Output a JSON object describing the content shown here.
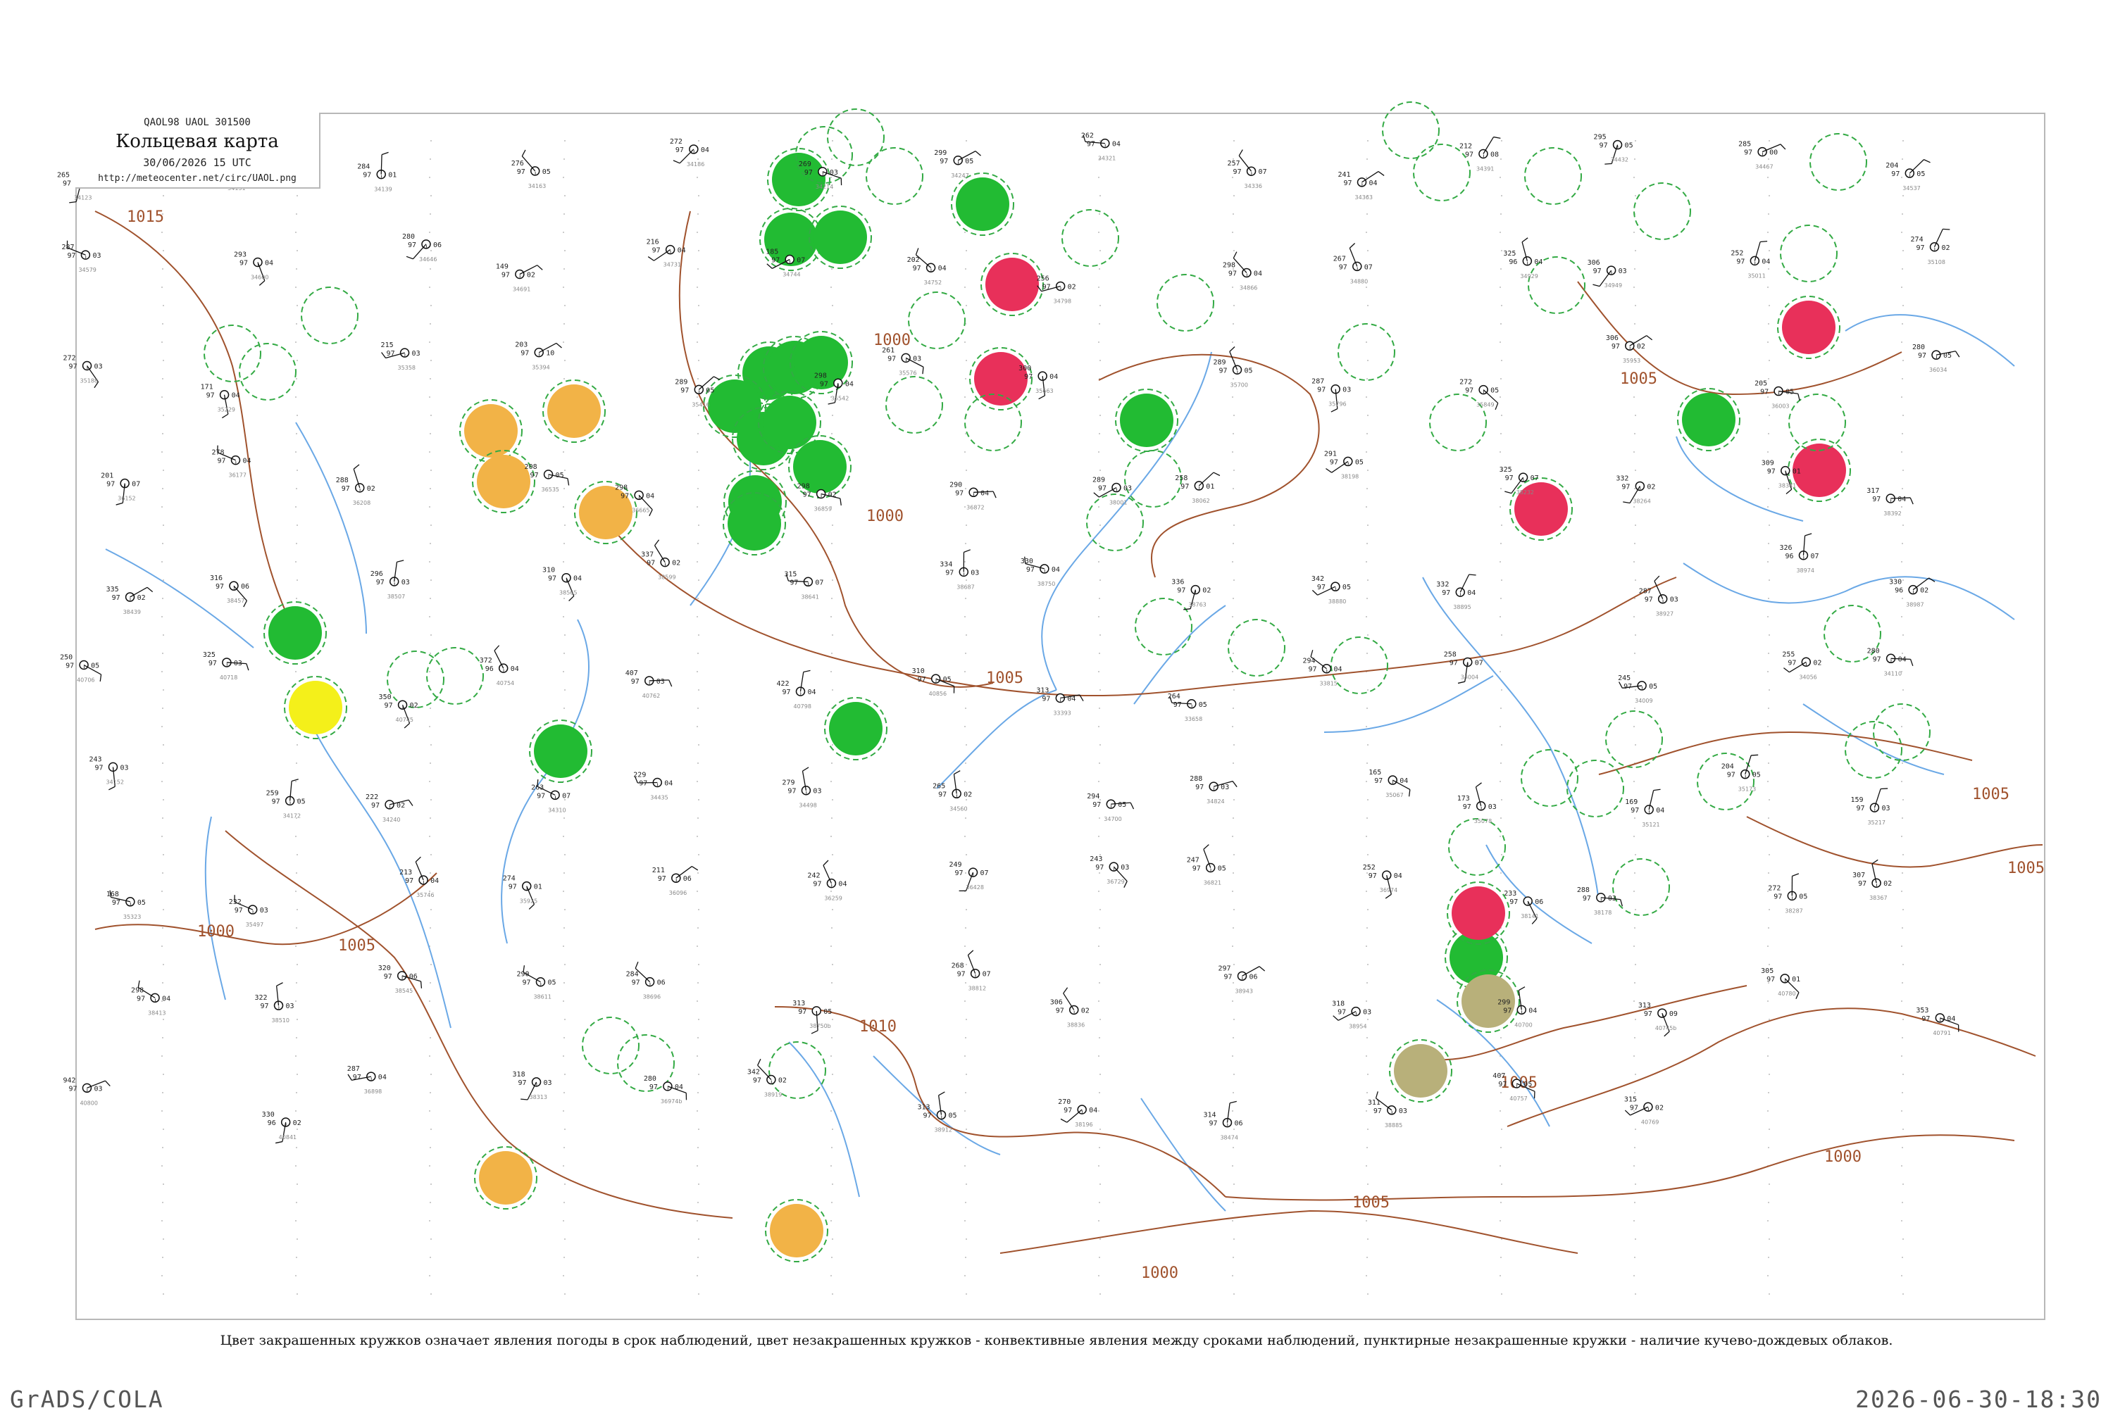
{
  "header": {
    "code": "QAOL98 UAOL 301500",
    "title": "Кольцевая карта",
    "date": "30/06/2026 15 UTC",
    "url": "http://meteocenter.net/circ/UAOL.png"
  },
  "caption": "Цвет закрашенных кружков означает явления погоды в срок наблюдений, цвет незакрашенных кружков - конвективные явления между сроками наблюдений, пунктирные незакрашенные кружки - наличие кучево-дождевых облаков.",
  "footer": {
    "left": "GrADS/COLA",
    "right": "2026-06-30-18:30"
  },
  "colors": {
    "isobar": "#a0522d",
    "river": "#6aa8e6",
    "thunder": "#22bb33",
    "rain": "#e8305a",
    "haze": "#f2b347",
    "dust": "#b8b07a",
    "fog": "#f4f01a",
    "cb_dashed": "#33aa44"
  },
  "isobars": [
    {
      "label": "1015"
    },
    {
      "label": "1010"
    },
    {
      "label": "1005"
    },
    {
      "label": "1000"
    },
    {
      "label": "995"
    }
  ],
  "stations": [
    {
      "code": "34123",
      "t": "265",
      "p": "97",
      "v": "05"
    },
    {
      "code": "34131",
      "t": "280",
      "p": "97",
      "v": "07"
    },
    {
      "code": "34139",
      "t": "284",
      "p": "97",
      "v": "01"
    },
    {
      "code": "34163",
      "t": "276",
      "p": "97",
      "v": "05"
    },
    {
      "code": "34186",
      "t": "272",
      "p": "97",
      "v": "04"
    },
    {
      "code": "34214",
      "t": "269",
      "p": "97",
      "v": "03"
    },
    {
      "code": "34247",
      "t": "299",
      "p": "97",
      "v": "05"
    },
    {
      "code": "34321",
      "t": "262",
      "p": "97",
      "v": "04"
    },
    {
      "code": "34336",
      "t": "257",
      "p": "97",
      "v": "07"
    },
    {
      "code": "34363",
      "t": "241",
      "p": "97",
      "v": "04"
    },
    {
      "code": "34391",
      "t": "212",
      "p": "97",
      "v": "08"
    },
    {
      "code": "34432",
      "t": "295",
      "p": "97",
      "v": "05"
    },
    {
      "code": "34467",
      "t": "285",
      "p": "97",
      "v": "00"
    },
    {
      "code": "34537",
      "t": "204",
      "p": "97",
      "v": "05"
    },
    {
      "code": "34579",
      "t": "287",
      "p": "97",
      "v": "03"
    },
    {
      "code": "34600",
      "t": "293",
      "p": "97",
      "v": "04"
    },
    {
      "code": "34646",
      "t": "280",
      "p": "97",
      "v": "06"
    },
    {
      "code": "34691",
      "t": "149",
      "p": "97",
      "v": "02"
    },
    {
      "code": "34731",
      "t": "216",
      "p": "97",
      "v": "04"
    },
    {
      "code": "34744",
      "t": "185",
      "p": "97",
      "v": "07"
    },
    {
      "code": "34752",
      "t": "202",
      "p": "97",
      "v": "04"
    },
    {
      "code": "34798",
      "t": "256",
      "p": "97",
      "v": "02"
    },
    {
      "code": "34866",
      "t": "298",
      "p": "97",
      "v": "04"
    },
    {
      "code": "34880",
      "t": "267",
      "p": "97",
      "v": "07"
    },
    {
      "code": "34929",
      "t": "325",
      "p": "96",
      "v": "04"
    },
    {
      "code": "34949",
      "t": "306",
      "p": "97",
      "v": "03"
    },
    {
      "code": "35011",
      "t": "252",
      "p": "97",
      "v": "04"
    },
    {
      "code": "35108",
      "t": "274",
      "p": "97",
      "v": "02"
    },
    {
      "code": "35188",
      "t": "272",
      "p": "97",
      "v": "03"
    },
    {
      "code": "35229",
      "t": "171",
      "p": "97",
      "v": "04"
    },
    {
      "code": "35358",
      "t": "215",
      "p": "97",
      "v": "03"
    },
    {
      "code": "35394",
      "t": "203",
      "p": "97",
      "v": "10"
    },
    {
      "code": "35416",
      "t": "289",
      "p": "97",
      "v": "05"
    },
    {
      "code": "35542",
      "t": "298",
      "p": "97",
      "v": "04"
    },
    {
      "code": "35576",
      "t": "261",
      "p": "97",
      "v": "03"
    },
    {
      "code": "35663",
      "t": "300",
      "p": "97",
      "v": "04"
    },
    {
      "code": "35700",
      "t": "289",
      "p": "97",
      "v": "05"
    },
    {
      "code": "35796",
      "t": "287",
      "p": "97",
      "v": "03"
    },
    {
      "code": "35849",
      "t": "272",
      "p": "97",
      "v": "05"
    },
    {
      "code": "35953",
      "t": "306",
      "p": "97",
      "v": "02"
    },
    {
      "code": "36003",
      "t": "205",
      "p": "97",
      "v": "05"
    },
    {
      "code": "36034",
      "t": "280",
      "p": "97",
      "v": "05"
    },
    {
      "code": "36152",
      "t": "201",
      "p": "97",
      "v": "07"
    },
    {
      "code": "36177",
      "t": "278",
      "p": "97",
      "v": "04"
    },
    {
      "code": "36208",
      "t": "288",
      "p": "97",
      "v": "02"
    },
    {
      "code": "36535",
      "t": "208",
      "p": "97",
      "v": "05"
    },
    {
      "code": "36665",
      "t": "298",
      "p": "97",
      "v": "04"
    },
    {
      "code": "36859",
      "t": "298",
      "p": "97",
      "v": "02"
    },
    {
      "code": "36872",
      "t": "290",
      "p": "97",
      "v": "04"
    },
    {
      "code": "38001",
      "t": "289",
      "p": "97",
      "v": "03"
    },
    {
      "code": "38062",
      "t": "258",
      "p": "97",
      "v": "01"
    },
    {
      "code": "38198",
      "t": "291",
      "p": "97",
      "v": "05"
    },
    {
      "code": "38232",
      "t": "325",
      "p": "97",
      "v": "07"
    },
    {
      "code": "38264",
      "t": "332",
      "p": "97",
      "v": "02"
    },
    {
      "code": "38341",
      "t": "309",
      "p": "97",
      "v": "01"
    },
    {
      "code": "38392",
      "t": "317",
      "p": "97",
      "v": "04"
    },
    {
      "code": "38439",
      "t": "335",
      "p": "97",
      "v": "02"
    },
    {
      "code": "38457",
      "t": "316",
      "p": "97",
      "v": "06"
    },
    {
      "code": "38507",
      "t": "296",
      "p": "97",
      "v": "03"
    },
    {
      "code": "38565",
      "t": "310",
      "p": "97",
      "v": "04"
    },
    {
      "code": "38599",
      "t": "337",
      "p": "97",
      "v": "02"
    },
    {
      "code": "38641",
      "t": "315",
      "p": "97",
      "v": "07"
    },
    {
      "code": "38687",
      "t": "334",
      "p": "97",
      "v": "03"
    },
    {
      "code": "38750",
      "t": "330",
      "p": "97",
      "v": "04"
    },
    {
      "code": "38763",
      "t": "336",
      "p": "97",
      "v": "02"
    },
    {
      "code": "38880",
      "t": "342",
      "p": "97",
      "v": "05"
    },
    {
      "code": "38895",
      "t": "332",
      "p": "97",
      "v": "04"
    },
    {
      "code": "38927",
      "t": "287",
      "p": "97",
      "v": "03"
    },
    {
      "code": "38974",
      "t": "326",
      "p": "96",
      "v": "07"
    },
    {
      "code": "38987",
      "t": "330",
      "p": "96",
      "v": "02"
    },
    {
      "code": "40706",
      "t": "250",
      "p": "97",
      "v": "05"
    },
    {
      "code": "40718",
      "t": "325",
      "p": "97",
      "v": "03"
    },
    {
      "code": "40745",
      "t": "350",
      "p": "97",
      "v": "02"
    },
    {
      "code": "40754",
      "t": "372",
      "p": "96",
      "v": "04"
    },
    {
      "code": "40762",
      "t": "407",
      "p": "97",
      "v": "03"
    },
    {
      "code": "40798",
      "t": "422",
      "p": "97",
      "v": "04"
    },
    {
      "code": "40856",
      "t": "310",
      "p": "97",
      "v": "05"
    },
    {
      "code": "33393",
      "t": "313",
      "p": "97",
      "v": "04"
    },
    {
      "code": "33658",
      "t": "264",
      "p": "97",
      "v": "05"
    },
    {
      "code": "33815",
      "t": "294",
      "p": "97",
      "v": "04"
    },
    {
      "code": "34004",
      "t": "258",
      "p": "97",
      "v": "07"
    },
    {
      "code": "34009",
      "t": "245",
      "p": "97",
      "v": "05"
    },
    {
      "code": "34056",
      "t": "255",
      "p": "97",
      "v": "02"
    },
    {
      "code": "34110",
      "t": "280",
      "p": "97",
      "v": "04"
    },
    {
      "code": "34152",
      "t": "243",
      "p": "97",
      "v": "03"
    },
    {
      "code": "34172",
      "t": "259",
      "p": "97",
      "v": "05"
    },
    {
      "code": "34240",
      "t": "222",
      "p": "97",
      "v": "02"
    },
    {
      "code": "34310",
      "t": "263",
      "p": "97",
      "v": "07"
    },
    {
      "code": "34435",
      "t": "229",
      "p": "97",
      "v": "04"
    },
    {
      "code": "34498",
      "t": "279",
      "p": "97",
      "v": "03"
    },
    {
      "code": "34560",
      "t": "265",
      "p": "97",
      "v": "02"
    },
    {
      "code": "34700",
      "t": "294",
      "p": "97",
      "v": "05"
    },
    {
      "code": "34824",
      "t": "288",
      "p": "97",
      "v": "03"
    },
    {
      "code": "35067",
      "t": "165",
      "p": "97",
      "v": "04"
    },
    {
      "code": "35078",
      "t": "173",
      "p": "97",
      "v": "03"
    },
    {
      "code": "35121",
      "t": "169",
      "p": "97",
      "v": "04"
    },
    {
      "code": "35173",
      "t": "204",
      "p": "97",
      "v": "05"
    },
    {
      "code": "35217",
      "t": "159",
      "p": "97",
      "v": "03"
    },
    {
      "code": "35323",
      "t": "168",
      "p": "97",
      "v": "05"
    },
    {
      "code": "35497",
      "t": "232",
      "p": "97",
      "v": "03"
    },
    {
      "code": "35746",
      "t": "213",
      "p": "97",
      "v": "04"
    },
    {
      "code": "35925",
      "t": "274",
      "p": "97",
      "v": "01"
    },
    {
      "code": "36096",
      "t": "211",
      "p": "97",
      "v": "06"
    },
    {
      "code": "36259",
      "t": "242",
      "p": "97",
      "v": "04"
    },
    {
      "code": "36428",
      "t": "249",
      "p": "97",
      "v": "07"
    },
    {
      "code": "36729",
      "t": "243",
      "p": "97",
      "v": "03"
    },
    {
      "code": "36821",
      "t": "247",
      "p": "97",
      "v": "05"
    },
    {
      "code": "36974",
      "t": "252",
      "p": "97",
      "v": "04"
    },
    {
      "code": "38141",
      "t": "233",
      "p": "97",
      "v": "06"
    },
    {
      "code": "38178",
      "t": "288",
      "p": "97",
      "v": "03"
    },
    {
      "code": "38287",
      "t": "272",
      "p": "97",
      "v": "05"
    },
    {
      "code": "38367",
      "t": "307",
      "p": "97",
      "v": "02"
    },
    {
      "code": "38413",
      "t": "298",
      "p": "97",
      "v": "04"
    },
    {
      "code": "38510",
      "t": "322",
      "p": "97",
      "v": "03"
    },
    {
      "code": "38545",
      "t": "320",
      "p": "97",
      "v": "06"
    },
    {
      "code": "38611",
      "t": "290",
      "p": "97",
      "v": "05"
    },
    {
      "code": "38696",
      "t": "284",
      "p": "97",
      "v": "06"
    },
    {
      "code": "38750b",
      "t": "313",
      "p": "97",
      "v": "05"
    },
    {
      "code": "38812",
      "t": "268",
      "p": "97",
      "v": "07"
    },
    {
      "code": "38836",
      "t": "306",
      "p": "97",
      "v": "02"
    },
    {
      "code": "38943",
      "t": "297",
      "p": "97",
      "v": "06"
    },
    {
      "code": "38954",
      "t": "318",
      "p": "97",
      "v": "03"
    },
    {
      "code": "40700",
      "t": "299",
      "p": "97",
      "v": "04"
    },
    {
      "code": "40745b",
      "t": "313",
      "p": "97",
      "v": "09"
    },
    {
      "code": "40780",
      "t": "305",
      "p": "97",
      "v": "01"
    },
    {
      "code": "40791",
      "t": "353",
      "p": "97",
      "v": "04"
    },
    {
      "code": "40800",
      "t": "942",
      "p": "97",
      "v": "03"
    },
    {
      "code": "40841",
      "t": "330",
      "p": "96",
      "v": "02"
    },
    {
      "code": "36898",
      "t": "287",
      "p": "97",
      "v": "04"
    },
    {
      "code": "38313",
      "t": "318",
      "p": "97",
      "v": "03"
    },
    {
      "code": "36974b",
      "t": "280",
      "p": "97",
      "v": "04"
    },
    {
      "code": "38919",
      "t": "342",
      "p": "97",
      "v": "02"
    },
    {
      "code": "38912",
      "t": "313",
      "p": "97",
      "v": "05"
    },
    {
      "code": "38196",
      "t": "270",
      "p": "97",
      "v": "04"
    },
    {
      "code": "38474",
      "t": "314",
      "p": "97",
      "v": "06"
    },
    {
      "code": "38885",
      "t": "311",
      "p": "97",
      "v": "03"
    },
    {
      "code": "40757",
      "t": "407",
      "p": "97",
      "v": "05"
    },
    {
      "code": "40769",
      "t": "315",
      "p": "97",
      "v": "02"
    }
  ],
  "weather_circles": [
    {
      "kind": "thunder"
    },
    {
      "kind": "thunder"
    },
    {
      "kind": "thunder"
    },
    {
      "kind": "thunder"
    },
    {
      "kind": "thunder"
    },
    {
      "kind": "thunder"
    },
    {
      "kind": "thunder"
    },
    {
      "kind": "thunder"
    },
    {
      "kind": "thunder"
    },
    {
      "kind": "thunder"
    },
    {
      "kind": "thunder"
    },
    {
      "kind": "thunder"
    },
    {
      "kind": "thunder"
    },
    {
      "kind": "thunder"
    },
    {
      "kind": "thunder"
    },
    {
      "kind": "thunder"
    },
    {
      "kind": "thunder"
    },
    {
      "kind": "thunder"
    },
    {
      "kind": "thunder"
    },
    {
      "kind": "rain"
    },
    {
      "kind": "rain"
    },
    {
      "kind": "rain"
    },
    {
      "kind": "rain"
    },
    {
      "kind": "rain"
    },
    {
      "kind": "rain"
    },
    {
      "kind": "haze"
    },
    {
      "kind": "haze"
    },
    {
      "kind": "haze"
    },
    {
      "kind": "haze"
    },
    {
      "kind": "haze"
    },
    {
      "kind": "haze"
    },
    {
      "kind": "dust"
    },
    {
      "kind": "dust"
    },
    {
      "kind": "fog"
    }
  ]
}
